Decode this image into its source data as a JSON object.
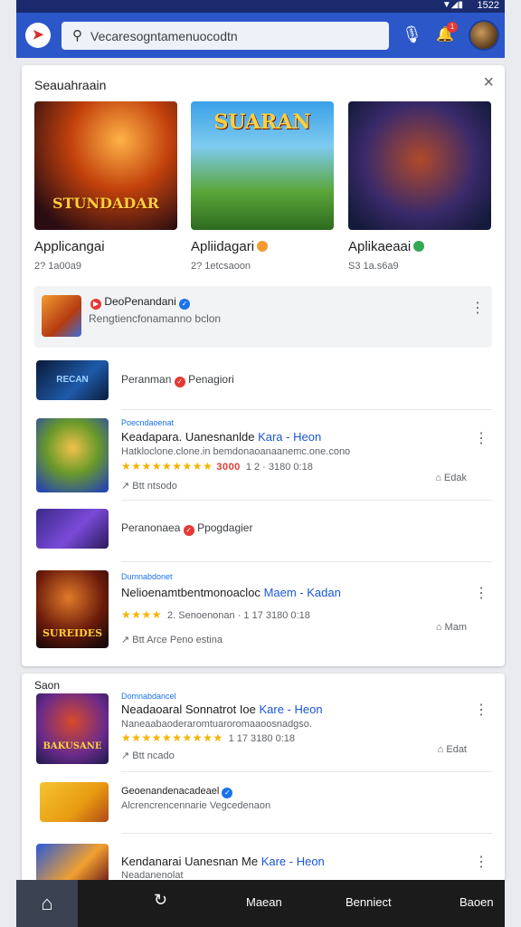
{
  "status": {
    "signal": "▼◢▮",
    "time": "1522"
  },
  "search": {
    "value": "Vecaresogntamenuocodtn",
    "placeholder": "Vecaresogntamenuocodtn"
  },
  "header": {
    "notification_count": "1"
  },
  "section1": {
    "title": "Seauahraain",
    "close": "×",
    "featured": [
      {
        "title": "Applicangai",
        "meta": "2? 1a00a9",
        "art": "STUNDADAR",
        "badge_color": ""
      },
      {
        "title": "Apliidagari",
        "meta": "2? 1etcsaoon",
        "art": "SUARAN",
        "badge_color": "#f29b30"
      },
      {
        "title": "Aplikaeaai",
        "meta": "S3 1a.s6a9",
        "art": "",
        "badge_color": "#34a853"
      }
    ],
    "featured_row": {
      "title": "DeoPenandani",
      "subtitle": "Rengtiencfonamanno bclon"
    },
    "rows": [
      {
        "kind": "small",
        "text_a": "Peranman",
        "text_b": "Penagiori",
        "icon_text": "RECAN"
      },
      {
        "kind": "big",
        "category": "Poecndaoenat",
        "title": "Keadapara. Uanesnanlde",
        "title_link": "Kara - Heon",
        "desc": "Hatkloclone.clone.in bemdonaoanaanemc.one.cono",
        "stars": "★★★★★★★★★",
        "price": "3000",
        "numbers": "1 2 · 3180 0:18",
        "foot": "Btt ntsodo",
        "side": "Edak"
      },
      {
        "kind": "small",
        "text_a": "Peranonaea",
        "text_b": "Ppogdagier",
        "icon_text": ""
      },
      {
        "kind": "big",
        "category": "Dumnabdonet",
        "title": "Nelioenamtbentmonoacloc",
        "title_link": "Maem - Kadan",
        "desc": "",
        "stars": "★★★★",
        "price": "",
        "numbers": "2. Senoenonan · 1 17 3180 0:18",
        "foot": "Btt Arce Peno estina",
        "side": "Mam",
        "icon_text": "SUREIDES"
      }
    ]
  },
  "section2": {
    "title": "Saon",
    "rows": [
      {
        "category": "Domnabdancel",
        "title": "Neadaoaral Sonnatrot Ioe",
        "title_link": "Kare - Heon",
        "desc": "Naneaabaoderaromtuaroromaaoosnadgso.",
        "stars": "★★★★★★★★★★",
        "numbers": "1 17 3180 0:18",
        "foot": "Btt ncado",
        "side": "Edat",
        "icon_text": "BAKUSANE"
      },
      {
        "title": "Geoenandenacadeael",
        "subtitle": "Alcrencrencennarie Vegcedenaon"
      },
      {
        "title": "Kendanarai Uanesnan Me",
        "title_link": "Kare - Heon",
        "desc": "Neadanenolat"
      }
    ]
  },
  "nav": {
    "home": "⌂",
    "tab2_icon": "↻",
    "tab3": "Maean",
    "tab4": "Benniect",
    "tab5": "Baoen"
  }
}
